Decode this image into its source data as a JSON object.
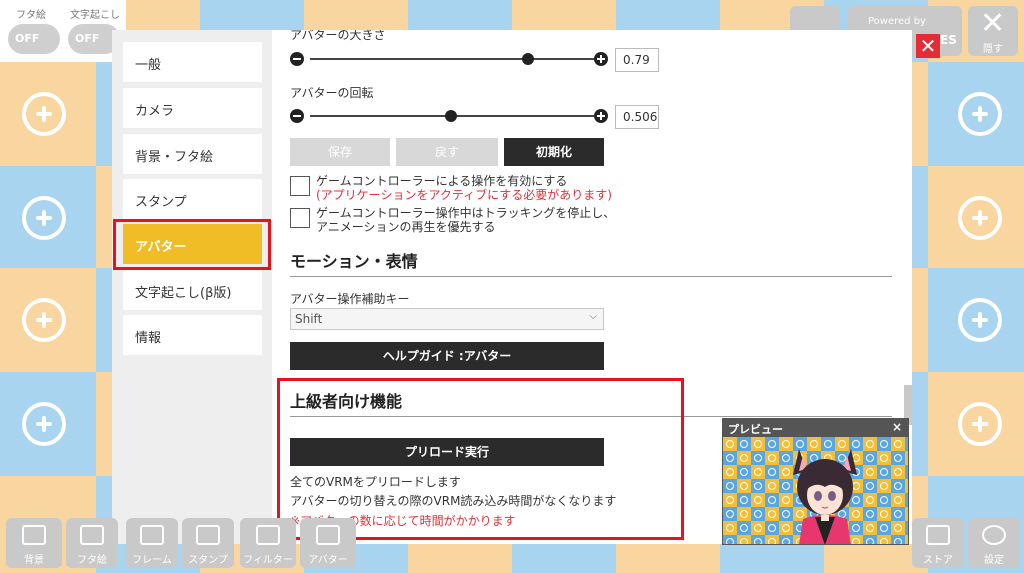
{
  "colors": {
    "blue": "#a8d4f0",
    "orange": "#f9d5a0",
    "accent": "#f0bd26",
    "highlight": "#e3141c"
  },
  "top": {
    "toggles": [
      {
        "title": "フタ絵",
        "state": "OFF"
      },
      {
        "title": "文字起こし",
        "state": "OFF"
      }
    ],
    "powered_by": "Powered by",
    "es_text": "ES",
    "hide_label": "隠す",
    "close_icon": "close-icon"
  },
  "sidebar": {
    "items": [
      {
        "label": "一般"
      },
      {
        "label": "カメラ"
      },
      {
        "label": "背景・フタ絵"
      },
      {
        "label": "スタンプ"
      },
      {
        "label": "アバター"
      },
      {
        "label": "文字起こし(β版)"
      },
      {
        "label": "情報"
      }
    ],
    "active_index": 4
  },
  "avatar": {
    "size_label": "アバターの大きさ",
    "size_value": "0.79",
    "rotation_label": "アバターの回転",
    "rotation_value": "0.506",
    "buttons": {
      "save": "保存",
      "revert": "戻す",
      "reset": "初期化"
    },
    "checkbox1": {
      "text": "ゲームコントローラーによる操作を有効にする",
      "warning": "(アプリケーションをアクティブにする必要があります)"
    },
    "checkbox2": {
      "line1": "ゲームコントローラー操作中はトラッキングを停止し、",
      "line2": "アニメーションの再生を優先する"
    }
  },
  "motion": {
    "title": "モーション・表情",
    "assist_key_label": "アバター操作補助キー",
    "assist_key_value": "Shift",
    "help_button": "ヘルプガイド :アバター"
  },
  "advanced": {
    "title": "上級者向け機能",
    "preload_button": "プリロード実行",
    "note1": "全てのVRMをプリロードします",
    "note2": "アバターの切り替えの際のVRM読み込み時間がなくなります",
    "note3": "※アバターの数に応じて時間がかかります"
  },
  "preview": {
    "title": "プレビュー",
    "close": "×"
  },
  "toolbar": {
    "left": [
      {
        "label": "背景",
        "icon": "background-icon"
      },
      {
        "label": "フタ絵",
        "icon": "cover-image-icon"
      },
      {
        "label": "フレーム",
        "icon": "frame-icon"
      },
      {
        "label": "スタンプ",
        "icon": "stamp-icon"
      },
      {
        "label": "フィルター",
        "icon": "filter-icon"
      },
      {
        "label": "アバター",
        "icon": "avatar-icon"
      }
    ],
    "right": [
      {
        "label": "ストア",
        "icon": "store-icon"
      },
      {
        "label": "設定",
        "icon": "settings-icon"
      }
    ]
  }
}
